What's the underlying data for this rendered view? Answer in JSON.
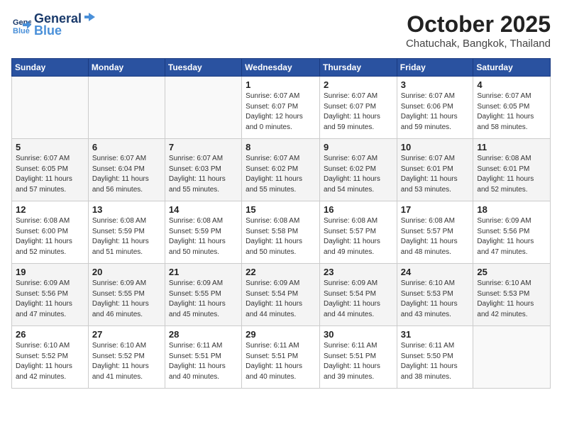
{
  "header": {
    "logo_line1": "General",
    "logo_line2": "Blue",
    "month": "October 2025",
    "location": "Chatuchak, Bangkok, Thailand"
  },
  "weekdays": [
    "Sunday",
    "Monday",
    "Tuesday",
    "Wednesday",
    "Thursday",
    "Friday",
    "Saturday"
  ],
  "weeks": [
    [
      {
        "day": "",
        "info": ""
      },
      {
        "day": "",
        "info": ""
      },
      {
        "day": "",
        "info": ""
      },
      {
        "day": "1",
        "info": "Sunrise: 6:07 AM\nSunset: 6:07 PM\nDaylight: 12 hours\nand 0 minutes."
      },
      {
        "day": "2",
        "info": "Sunrise: 6:07 AM\nSunset: 6:07 PM\nDaylight: 11 hours\nand 59 minutes."
      },
      {
        "day": "3",
        "info": "Sunrise: 6:07 AM\nSunset: 6:06 PM\nDaylight: 11 hours\nand 59 minutes."
      },
      {
        "day": "4",
        "info": "Sunrise: 6:07 AM\nSunset: 6:05 PM\nDaylight: 11 hours\nand 58 minutes."
      }
    ],
    [
      {
        "day": "5",
        "info": "Sunrise: 6:07 AM\nSunset: 6:05 PM\nDaylight: 11 hours\nand 57 minutes."
      },
      {
        "day": "6",
        "info": "Sunrise: 6:07 AM\nSunset: 6:04 PM\nDaylight: 11 hours\nand 56 minutes."
      },
      {
        "day": "7",
        "info": "Sunrise: 6:07 AM\nSunset: 6:03 PM\nDaylight: 11 hours\nand 55 minutes."
      },
      {
        "day": "8",
        "info": "Sunrise: 6:07 AM\nSunset: 6:02 PM\nDaylight: 11 hours\nand 55 minutes."
      },
      {
        "day": "9",
        "info": "Sunrise: 6:07 AM\nSunset: 6:02 PM\nDaylight: 11 hours\nand 54 minutes."
      },
      {
        "day": "10",
        "info": "Sunrise: 6:07 AM\nSunset: 6:01 PM\nDaylight: 11 hours\nand 53 minutes."
      },
      {
        "day": "11",
        "info": "Sunrise: 6:08 AM\nSunset: 6:01 PM\nDaylight: 11 hours\nand 52 minutes."
      }
    ],
    [
      {
        "day": "12",
        "info": "Sunrise: 6:08 AM\nSunset: 6:00 PM\nDaylight: 11 hours\nand 52 minutes."
      },
      {
        "day": "13",
        "info": "Sunrise: 6:08 AM\nSunset: 5:59 PM\nDaylight: 11 hours\nand 51 minutes."
      },
      {
        "day": "14",
        "info": "Sunrise: 6:08 AM\nSunset: 5:59 PM\nDaylight: 11 hours\nand 50 minutes."
      },
      {
        "day": "15",
        "info": "Sunrise: 6:08 AM\nSunset: 5:58 PM\nDaylight: 11 hours\nand 50 minutes."
      },
      {
        "day": "16",
        "info": "Sunrise: 6:08 AM\nSunset: 5:57 PM\nDaylight: 11 hours\nand 49 minutes."
      },
      {
        "day": "17",
        "info": "Sunrise: 6:08 AM\nSunset: 5:57 PM\nDaylight: 11 hours\nand 48 minutes."
      },
      {
        "day": "18",
        "info": "Sunrise: 6:09 AM\nSunset: 5:56 PM\nDaylight: 11 hours\nand 47 minutes."
      }
    ],
    [
      {
        "day": "19",
        "info": "Sunrise: 6:09 AM\nSunset: 5:56 PM\nDaylight: 11 hours\nand 47 minutes."
      },
      {
        "day": "20",
        "info": "Sunrise: 6:09 AM\nSunset: 5:55 PM\nDaylight: 11 hours\nand 46 minutes."
      },
      {
        "day": "21",
        "info": "Sunrise: 6:09 AM\nSunset: 5:55 PM\nDaylight: 11 hours\nand 45 minutes."
      },
      {
        "day": "22",
        "info": "Sunrise: 6:09 AM\nSunset: 5:54 PM\nDaylight: 11 hours\nand 44 minutes."
      },
      {
        "day": "23",
        "info": "Sunrise: 6:09 AM\nSunset: 5:54 PM\nDaylight: 11 hours\nand 44 minutes."
      },
      {
        "day": "24",
        "info": "Sunrise: 6:10 AM\nSunset: 5:53 PM\nDaylight: 11 hours\nand 43 minutes."
      },
      {
        "day": "25",
        "info": "Sunrise: 6:10 AM\nSunset: 5:53 PM\nDaylight: 11 hours\nand 42 minutes."
      }
    ],
    [
      {
        "day": "26",
        "info": "Sunrise: 6:10 AM\nSunset: 5:52 PM\nDaylight: 11 hours\nand 42 minutes."
      },
      {
        "day": "27",
        "info": "Sunrise: 6:10 AM\nSunset: 5:52 PM\nDaylight: 11 hours\nand 41 minutes."
      },
      {
        "day": "28",
        "info": "Sunrise: 6:11 AM\nSunset: 5:51 PM\nDaylight: 11 hours\nand 40 minutes."
      },
      {
        "day": "29",
        "info": "Sunrise: 6:11 AM\nSunset: 5:51 PM\nDaylight: 11 hours\nand 40 minutes."
      },
      {
        "day": "30",
        "info": "Sunrise: 6:11 AM\nSunset: 5:51 PM\nDaylight: 11 hours\nand 39 minutes."
      },
      {
        "day": "31",
        "info": "Sunrise: 6:11 AM\nSunset: 5:50 PM\nDaylight: 11 hours\nand 38 minutes."
      },
      {
        "day": "",
        "info": ""
      }
    ]
  ]
}
